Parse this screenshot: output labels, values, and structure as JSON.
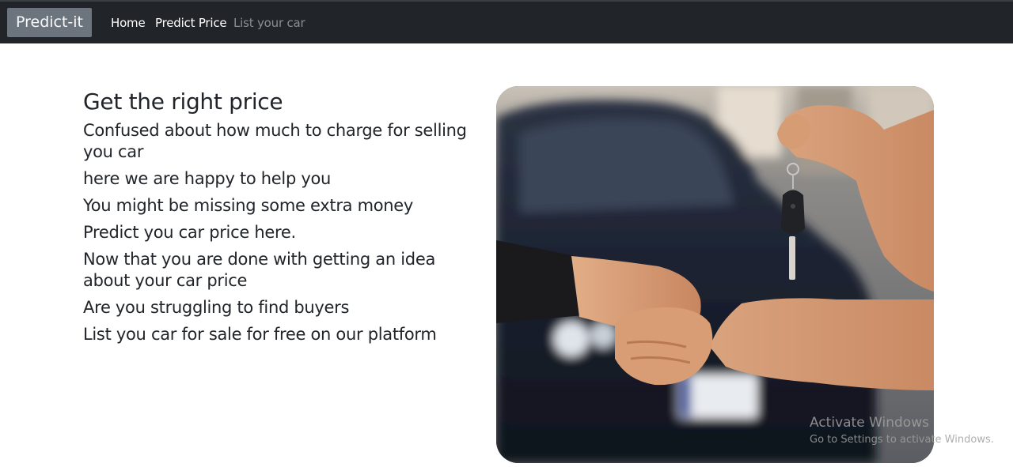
{
  "navbar": {
    "brand": "Predict-it",
    "links": [
      {
        "label": "Home"
      },
      {
        "label": "Predict Price"
      },
      {
        "label": "List your car"
      }
    ]
  },
  "main": {
    "heading": "Get the right price",
    "paragraphs": [
      "Confused about how much to charge for selling you car",
      "here we are happy to help you",
      "You might be missing some extra money",
      "Predict you car price here.",
      "Now that you are done with getting an idea about your car price",
      "Are you struggling to find buyers",
      "List you car for sale for free on our platform"
    ]
  },
  "watermark": {
    "title": "Activate Windows",
    "subtitle": "Go to Settings to activate Windows."
  },
  "colors": {
    "navbar_bg": "#212529",
    "brand_bg": "#6c757d",
    "text": "#212529",
    "muted_link": "#8a8f94"
  }
}
